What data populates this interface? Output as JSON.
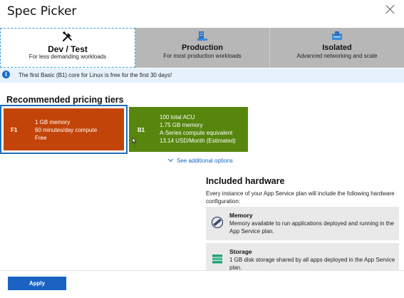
{
  "header": {
    "title": "Spec Picker"
  },
  "tabs": [
    {
      "name": "Dev / Test",
      "description": "For less demanding workloads",
      "icon": "tools-icon",
      "selected": true
    },
    {
      "name": "Production",
      "description": "For most production workloads",
      "icon": "server-icon",
      "selected": false
    },
    {
      "name": "Isolated",
      "description": "Advanced networking and scale",
      "icon": "isolated-server-icon",
      "selected": false
    }
  ],
  "info": {
    "text": "The first Basic (B1) core for Linux is free for the first 30 days!"
  },
  "recommended": {
    "title": "Recommended pricing tiers",
    "tiers": [
      {
        "id": "F1",
        "lines": [
          "1 GB memory",
          "60 minutes/day compute",
          "Free"
        ],
        "color": "#c34408",
        "selected": true
      },
      {
        "id": "B1",
        "lines": [
          "100 total ACU",
          "1.75 GB memory",
          "A-Series compute equivalent",
          "13.14 USD/Month (Estimated)"
        ],
        "color": "#57860e",
        "selected": false
      }
    ],
    "see_more": "See additional options"
  },
  "hardware": {
    "title": "Included hardware",
    "description": "Every instance of your App Service plan will include the following hardware configuration:",
    "items": [
      {
        "name": "Memory",
        "description": "Memory available to run applications deployed and running in the App Service plan.",
        "icon": "memory-icon"
      },
      {
        "name": "Storage",
        "description": "1 GB disk storage shared by all apps deployed in the App Service plan.",
        "icon": "storage-icon"
      }
    ]
  },
  "footer": {
    "apply_label": "Apply"
  }
}
